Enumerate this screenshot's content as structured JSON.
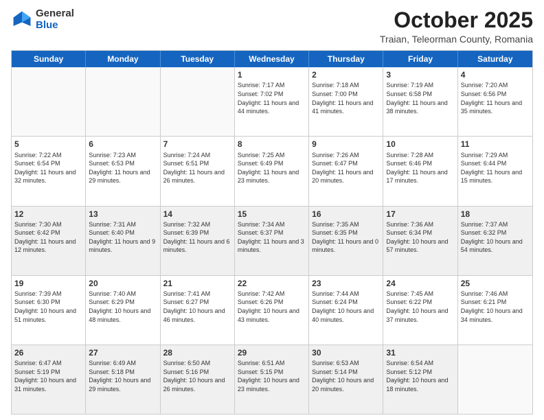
{
  "header": {
    "logo_general": "General",
    "logo_blue": "Blue",
    "main_title": "October 2025",
    "subtitle": "Traian, Teleorman County, Romania"
  },
  "days_of_week": [
    "Sunday",
    "Monday",
    "Tuesday",
    "Wednesday",
    "Thursday",
    "Friday",
    "Saturday"
  ],
  "weeks": [
    [
      {
        "day": "",
        "text": "",
        "empty": true
      },
      {
        "day": "",
        "text": "",
        "empty": true
      },
      {
        "day": "",
        "text": "",
        "empty": true
      },
      {
        "day": "1",
        "text": "Sunrise: 7:17 AM\nSunset: 7:02 PM\nDaylight: 11 hours and 44 minutes."
      },
      {
        "day": "2",
        "text": "Sunrise: 7:18 AM\nSunset: 7:00 PM\nDaylight: 11 hours and 41 minutes."
      },
      {
        "day": "3",
        "text": "Sunrise: 7:19 AM\nSunset: 6:58 PM\nDaylight: 11 hours and 38 minutes."
      },
      {
        "day": "4",
        "text": "Sunrise: 7:20 AM\nSunset: 6:56 PM\nDaylight: 11 hours and 35 minutes."
      }
    ],
    [
      {
        "day": "5",
        "text": "Sunrise: 7:22 AM\nSunset: 6:54 PM\nDaylight: 11 hours and 32 minutes."
      },
      {
        "day": "6",
        "text": "Sunrise: 7:23 AM\nSunset: 6:53 PM\nDaylight: 11 hours and 29 minutes."
      },
      {
        "day": "7",
        "text": "Sunrise: 7:24 AM\nSunset: 6:51 PM\nDaylight: 11 hours and 26 minutes."
      },
      {
        "day": "8",
        "text": "Sunrise: 7:25 AM\nSunset: 6:49 PM\nDaylight: 11 hours and 23 minutes."
      },
      {
        "day": "9",
        "text": "Sunrise: 7:26 AM\nSunset: 6:47 PM\nDaylight: 11 hours and 20 minutes."
      },
      {
        "day": "10",
        "text": "Sunrise: 7:28 AM\nSunset: 6:46 PM\nDaylight: 11 hours and 17 minutes."
      },
      {
        "day": "11",
        "text": "Sunrise: 7:29 AM\nSunset: 6:44 PM\nDaylight: 11 hours and 15 minutes."
      }
    ],
    [
      {
        "day": "12",
        "text": "Sunrise: 7:30 AM\nSunset: 6:42 PM\nDaylight: 11 hours and 12 minutes.",
        "shaded": true
      },
      {
        "day": "13",
        "text": "Sunrise: 7:31 AM\nSunset: 6:40 PM\nDaylight: 11 hours and 9 minutes.",
        "shaded": true
      },
      {
        "day": "14",
        "text": "Sunrise: 7:32 AM\nSunset: 6:39 PM\nDaylight: 11 hours and 6 minutes.",
        "shaded": true
      },
      {
        "day": "15",
        "text": "Sunrise: 7:34 AM\nSunset: 6:37 PM\nDaylight: 11 hours and 3 minutes.",
        "shaded": true
      },
      {
        "day": "16",
        "text": "Sunrise: 7:35 AM\nSunset: 6:35 PM\nDaylight: 11 hours and 0 minutes.",
        "shaded": true
      },
      {
        "day": "17",
        "text": "Sunrise: 7:36 AM\nSunset: 6:34 PM\nDaylight: 10 hours and 57 minutes.",
        "shaded": true
      },
      {
        "day": "18",
        "text": "Sunrise: 7:37 AM\nSunset: 6:32 PM\nDaylight: 10 hours and 54 minutes.",
        "shaded": true
      }
    ],
    [
      {
        "day": "19",
        "text": "Sunrise: 7:39 AM\nSunset: 6:30 PM\nDaylight: 10 hours and 51 minutes."
      },
      {
        "day": "20",
        "text": "Sunrise: 7:40 AM\nSunset: 6:29 PM\nDaylight: 10 hours and 48 minutes."
      },
      {
        "day": "21",
        "text": "Sunrise: 7:41 AM\nSunset: 6:27 PM\nDaylight: 10 hours and 46 minutes."
      },
      {
        "day": "22",
        "text": "Sunrise: 7:42 AM\nSunset: 6:26 PM\nDaylight: 10 hours and 43 minutes."
      },
      {
        "day": "23",
        "text": "Sunrise: 7:44 AM\nSunset: 6:24 PM\nDaylight: 10 hours and 40 minutes."
      },
      {
        "day": "24",
        "text": "Sunrise: 7:45 AM\nSunset: 6:22 PM\nDaylight: 10 hours and 37 minutes."
      },
      {
        "day": "25",
        "text": "Sunrise: 7:46 AM\nSunset: 6:21 PM\nDaylight: 10 hours and 34 minutes."
      }
    ],
    [
      {
        "day": "26",
        "text": "Sunrise: 6:47 AM\nSunset: 5:19 PM\nDaylight: 10 hours and 31 minutes.",
        "shaded": true
      },
      {
        "day": "27",
        "text": "Sunrise: 6:49 AM\nSunset: 5:18 PM\nDaylight: 10 hours and 29 minutes.",
        "shaded": true
      },
      {
        "day": "28",
        "text": "Sunrise: 6:50 AM\nSunset: 5:16 PM\nDaylight: 10 hours and 26 minutes.",
        "shaded": true
      },
      {
        "day": "29",
        "text": "Sunrise: 6:51 AM\nSunset: 5:15 PM\nDaylight: 10 hours and 23 minutes.",
        "shaded": true
      },
      {
        "day": "30",
        "text": "Sunrise: 6:53 AM\nSunset: 5:14 PM\nDaylight: 10 hours and 20 minutes.",
        "shaded": true
      },
      {
        "day": "31",
        "text": "Sunrise: 6:54 AM\nSunset: 5:12 PM\nDaylight: 10 hours and 18 minutes.",
        "shaded": true
      },
      {
        "day": "",
        "text": "",
        "empty": true,
        "shaded": false
      }
    ]
  ]
}
